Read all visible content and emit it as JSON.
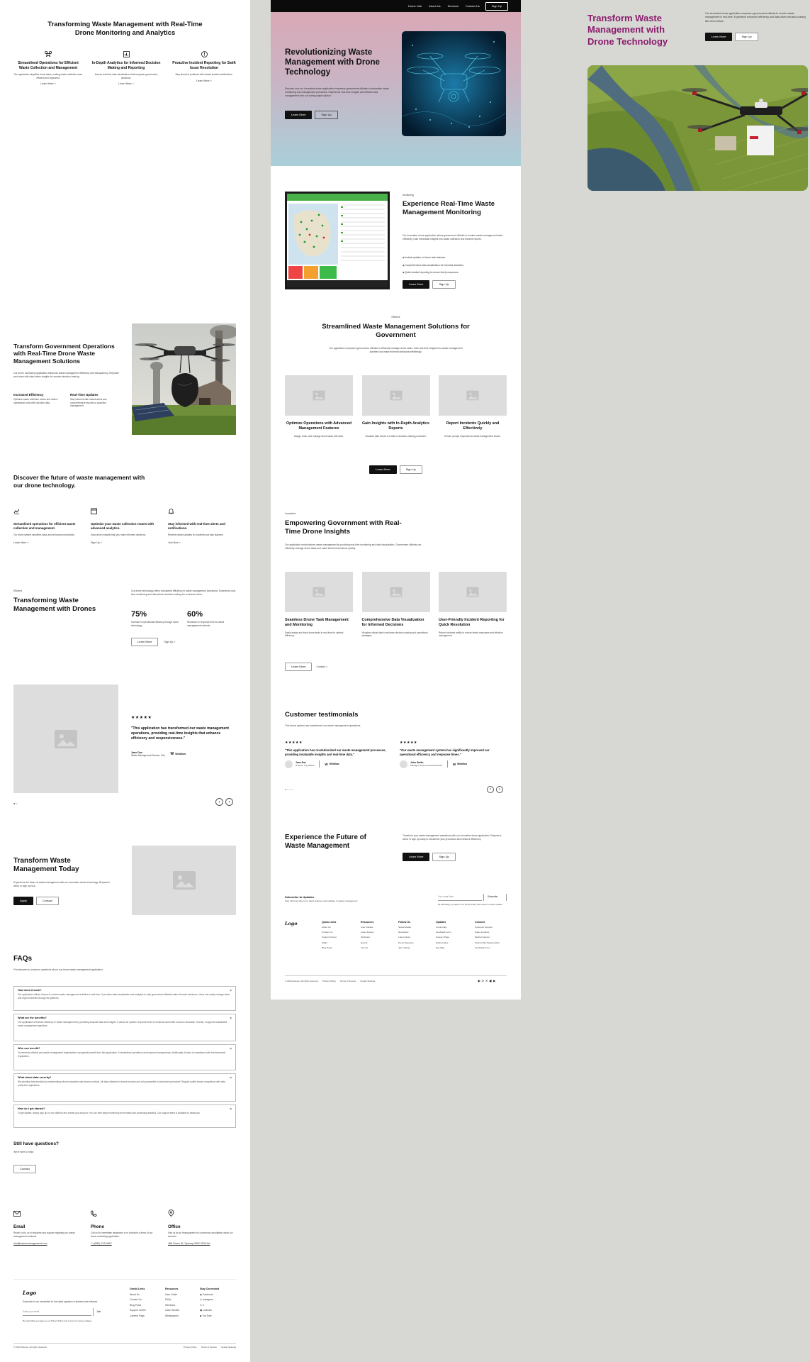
{
  "pageA": {
    "hero": {
      "title": "Transforming Waste Management with Real-Time Drone Monitoring and Analytics",
      "features": [
        {
          "icon": "drone-icon",
          "title": "Streamlined Operations for Efficient Waste Collection and Management",
          "text": "Our application simplifies drone tasks, making waste collection more efficient and organized.",
          "link": "Learn More >"
        },
        {
          "icon": "chart-icon",
          "title": "In-Depth Analytics for Informed Decision Making and Reporting",
          "text": "Access real-time data visualizations that empower government decisions.",
          "link": "Learn More >"
        },
        {
          "icon": "alert-icon",
          "title": "Proactive Incident Reporting for Swift Issue Resolution",
          "text": "Stay ahead of problems with instant incident notifications.",
          "link": "Learn More >"
        }
      ]
    },
    "gov": {
      "title": "Transform Government Operations with Real-Time Drone Waste Management Solutions",
      "text": "Our drone monitoring application enhances waste management efficiency and transparency. Empower your team with data-driven insights for smarter decision-making.",
      "stats": [
        {
          "title": "Increased Efficiency",
          "text": "Optimize waste collection routes and reduce operational costs with real-time data."
        },
        {
          "title": "Real-Time Updates",
          "text": "Stay informed with instant alerts and comprehensive reports for proactive management."
        }
      ]
    },
    "discover": {
      "title": "Discover the future of waste management with our drone technology.",
      "items": [
        {
          "icon": "drone-icon",
          "title": "Streamlined operations for efficient waste collection and management.",
          "text": "Our drone system simplifies tasks and enhances productivity.",
          "link": "Learn More >"
        },
        {
          "icon": "calendar-icon",
          "title": "Optimize your waste collection routes with advanced analytics.",
          "text": "Data-driven insights help you make informed decisions.",
          "link": "Sign Up >"
        },
        {
          "icon": "bell-icon",
          "title": "Stay informed with real-time alerts and notifications.",
          "text": "Receive instant updates on incidents and task statuses.",
          "link": "Join Now >"
        }
      ]
    },
    "drones": {
      "tag": "Efficient",
      "title": "Transforming Waste Management with Drones",
      "text": "Our drone technology offers unmatched efficiency in waste management operations. Experience real-time monitoring and data-driven decision-making for a cleaner future.",
      "stats": [
        {
          "value": "75%",
          "text": "Increase in operational efficiency through drone technology."
        },
        {
          "value": "60%",
          "text": "Reduction in response time for waste management incidents."
        }
      ],
      "btn1": "Learn More",
      "btn2": "Sign Up >"
    },
    "testimonial": {
      "stars": "★★★★★",
      "quote": "\"This application has transformed our waste management operations, providing real-time insights that enhance efficiency and responsiveness.\"",
      "name": "Jane Doe",
      "role": "Waste Management Director, City",
      "company": "Webflow"
    },
    "today": {
      "title": "Transform Waste Management Today",
      "text": "Experience the future of waste management with our innovative drone technology. Request a demo or sign up now.",
      "btn1": "Apply",
      "btn2": "Contact"
    },
    "faq": {
      "title": "FAQs",
      "intro": "Find answers to common questions about our drone waste management application.",
      "items": [
        {
          "q": "How does it work?",
          "a": "Our application utilizes drones to monitor waste management activities in real-time. It provides data visualization and analytics to help government officials make informed decisions. Users can easily manage tasks and report incidents through the platform."
        },
        {
          "q": "What are the benefits?",
          "a": "The application enhances efficiency in waste management by providing accurate data and insights. It allows for quicker response times to incidents and better resource allocation. Overall, it supports sustainable waste management practices."
        },
        {
          "q": "Who can benefit?",
          "a": "Government officials and waste management organizations can greatly benefit from this application. It streamlines operations and improves transparency. Additionally, it helps in compliance with environmental regulations."
        },
        {
          "q": "What about data security?",
          "a": "We prioritize data security by implementing robust encryption and access controls. All data collected is stored securely and only accessible to authorized personnel. Regular audits ensure compliance with data protection regulations."
        },
        {
          "q": "How do I get started?",
          "a": "To get started, simply sign up on our platform and create your account. You can then begin monitoring drone tasks and accessing analytics. Our support team is available to assist you."
        }
      ],
      "more_title": "Still have questions?",
      "more_text": "We're here to help!",
      "more_btn": "Contact"
    },
    "contact": [
      {
        "icon": "mail-icon",
        "title": "Email",
        "text": "Reach out to us for inquiries and support regarding our waste management solutions.",
        "value": "info@wastemanagement.com"
      },
      {
        "icon": "phone-icon",
        "title": "Phone",
        "text": "Call us for immediate assistance or to schedule a demo of our drone monitoring application.",
        "value": "+1 (555) 123-4567"
      },
      {
        "icon": "pin-icon",
        "title": "Office",
        "text": "Visit us at our headquarters for a personal consultation about our services.",
        "value": "456 Green St, Sydney NSW 2000 AU"
      }
    ],
    "footer": {
      "logo": "Logo",
      "text": "Subscribe to our newsletter for the latest updates on features and releases.",
      "input_placeholder": "Enter your email",
      "join": "Join",
      "legal_note": "By subscribing you agree to our Privacy Policy and consent to receive updates.",
      "cols": [
        {
          "title": "Useful Links",
          "items": [
            "About Us",
            "Contact Us",
            "Blog Posts",
            "Support Center",
            "Careers Page"
          ]
        },
        {
          "title": "Resources",
          "items": [
            "User Guide",
            "FAQs",
            "Webinars",
            "Case Studies",
            "Whitepapers"
          ]
        },
        {
          "title": "Stay Connected",
          "items": [
            "Facebook",
            "Instagram",
            "X",
            "LinkedIn",
            "YouTube"
          ]
        }
      ],
      "copyright": "© 2024 Relume. All rights reserved.",
      "links": [
        "Privacy Policy",
        "Terms of Service",
        "Cookie Settings"
      ]
    }
  },
  "pageB": {
    "nav": [
      "Home Link",
      "About Us",
      "Services",
      "Contact Us"
    ],
    "nav_btn": "Sign Up",
    "hero": {
      "title": "Revolutionizing Waste Management with Drone Technology",
      "text": "Discover how our innovative drone application empowers government officials to streamline waste monitoring and management processes. Experience real-time insights and efficient task management with our cutting-edge solution.",
      "btn1": "Learn More",
      "btn2": "Sign Up"
    },
    "realtime": {
      "tag": "Monitoring",
      "title": "Experience Real-Time Waste Management Monitoring",
      "text": "Our innovative drone application allows government officials to monitor waste management tasks efficiently. Gain immediate insights into waste collection and incident reports.",
      "bullets": [
        "Instant updates on drone task statuses.",
        "Comprehensive data visualization for informed decisions.",
        "Quick incident reporting to ensure timely responses."
      ],
      "btn1": "Learn More",
      "btn2": "Sign Up"
    },
    "streamlined": {
      "tag": "Efficient",
      "title": "Streamlined Waste Management Solutions for Government",
      "text": "Our application empowers government officials to efficiently manage drone tasks. Gain real-time insights into waste management activities and make informed decisions effortlessly.",
      "cards": [
        {
          "title": "Optimize Operations with Advanced Management Features",
          "text": "Assign, track, and manage drone tasks with ease."
        },
        {
          "title": "Gain Insights with In-Depth Analytics Reports",
          "text": "Visualize data trends to enhance decision-making processes."
        },
        {
          "title": "Report Incidents Quickly and Effectively",
          "text": "Ensure prompt responses to waste management issues."
        }
      ],
      "btn1": "Learn More",
      "btn2": "Sign Up"
    },
    "empower": {
      "tag": "Innovative",
      "title": "Empowering Government with Real-Time Drone Insights",
      "text": "Our application revolutionizes waste management by providing real-time monitoring and data visualization. Government officials can efficiently manage drone tasks and make informed decisions quickly.",
      "cards": [
        {
          "title": "Seamless Drone Task Management and Monitoring",
          "text": "Easily assign and track drone tasks in real-time for optimal efficiency."
        },
        {
          "title": "Comprehensive Data Visualization for Informed Decisions",
          "text": "Visualize critical data to enhance decision-making and operational strategies."
        },
        {
          "title": "User-Friendly Incident Reporting for Quick Resolution",
          "text": "Report incidents swiftly to ensure timely responses and effective management."
        }
      ],
      "btn1": "Learn More",
      "btn2": "Contact >"
    },
    "testimonials": {
      "title": "Customer testimonials",
      "sub": "This drone system has transformed our waste management operations.",
      "items": [
        {
          "stars": "★★★★★",
          "quote": "\"This application has revolutionized our waste management processes, providing invaluable insights and real-time data.\"",
          "name": "Jane Doe",
          "role": "Director, City Waste",
          "company": "Webflow"
        },
        {
          "stars": "★★★★★",
          "quote": "\"Our waste management system has significantly improved our operational efficiency and response times.\"",
          "name": "John Smith",
          "role": "Manager, Environmental Services",
          "company": "Webflow"
        }
      ]
    },
    "cta": {
      "title": "Experience the Future of Waste Management",
      "text": "Transform your waste management operations with our innovative drone application. Request a demo or sign up today to streamline your processes and enhance efficiency.",
      "btn1": "Learn More",
      "btn2": "Sign Up"
    },
    "footer": {
      "sub_title": "Subscribe to Updates",
      "sub_text": "Stay informed about our latest features and updates in waste management.",
      "input_placeholder": "Your email here",
      "sub_btn": "Subscribe",
      "note": "By subscribing, you agree to our Privacy Policy and consent to receive updates.",
      "logo": "Logo",
      "cols": [
        {
          "title": "Quick Links",
          "items": [
            "About Us",
            "Contact Us",
            "Support Center",
            "FAQs",
            "Blog Posts"
          ]
        },
        {
          "title": "Resources",
          "items": [
            "User Guides",
            "Case Studies",
            "Webinars",
            "Events",
            "Join Us"
          ]
        },
        {
          "title": "Follow Us",
          "items": [
            "Social Media",
            "Newsletter",
            "Latest News",
            "Press Releases",
            "Job Listings"
          ]
        },
        {
          "title": "Updates",
          "items": [
            "Community",
            "Feedback Form",
            "Careers Page",
            "Partnerships",
            "Site Map"
          ]
        },
        {
          "title": "Connect",
          "items": [
            "Customer Support",
            "Sales Inquiries",
            "Media Inquiries",
            "Partnership Opportunities",
            "Feedback Form"
          ]
        }
      ],
      "copyright": "© 2024 Relume. All rights reserved.",
      "links": [
        "Privacy Policy",
        "Terms of Service",
        "Cookie Settings"
      ]
    }
  },
  "pageC": {
    "title": "Transform Waste Management with Drone Technology",
    "text": "Our innovative drone application empowers government officials to monitor waste management in real-time. Experience enhanced efficiency and data-driven decision-making like never before.",
    "btn1": "Learn More",
    "btn2": "Sign Up",
    "title_color": "#8a1c6e"
  }
}
